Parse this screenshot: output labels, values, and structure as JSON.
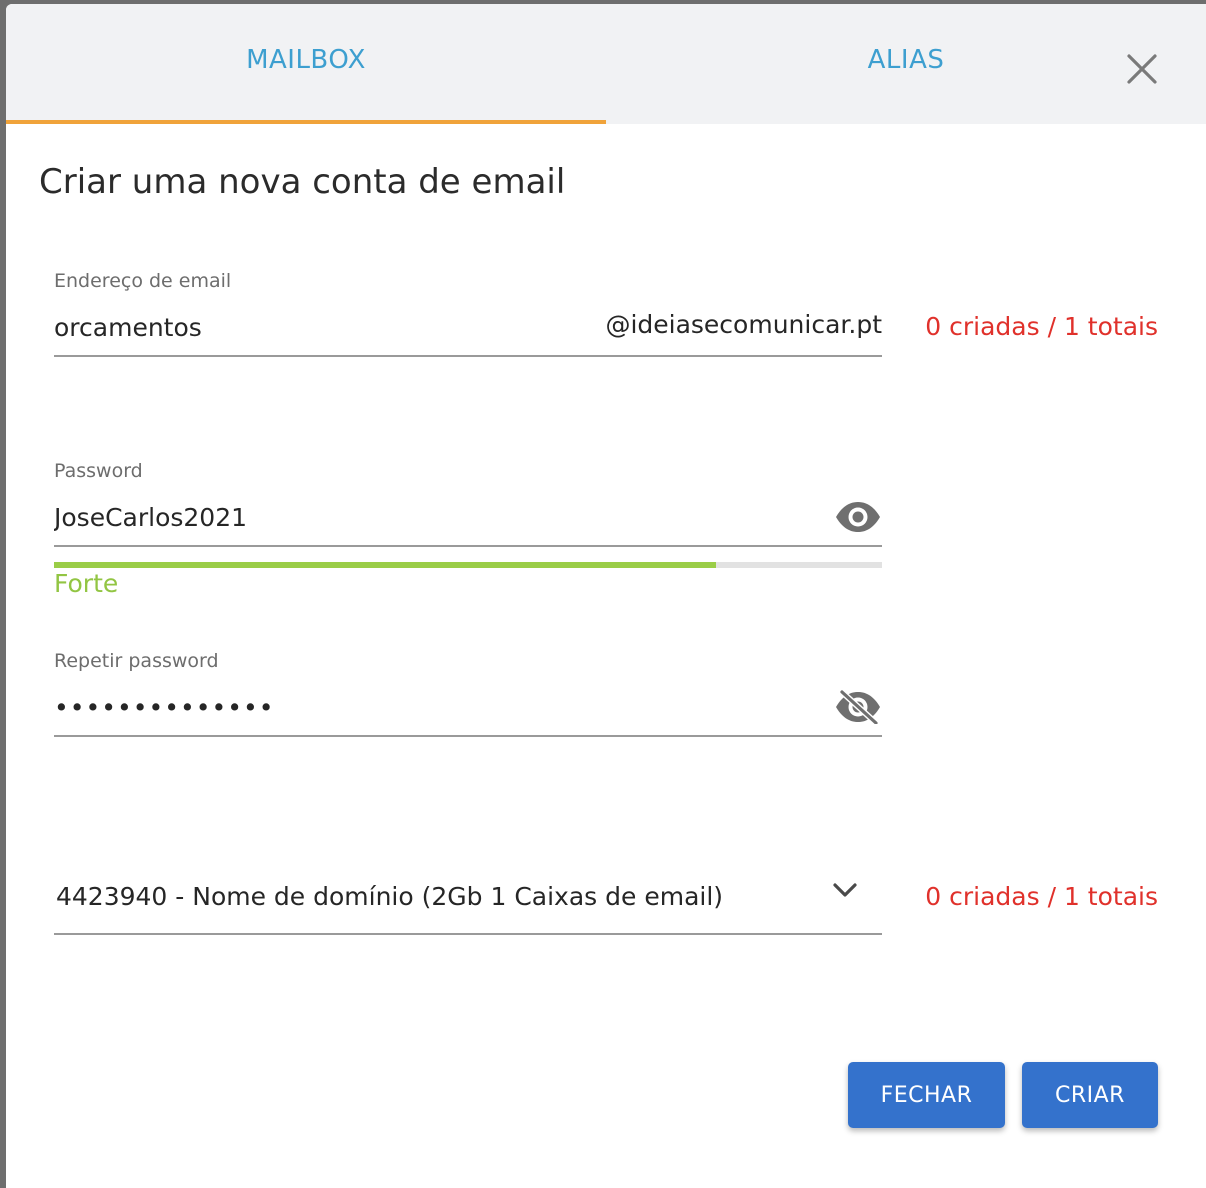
{
  "tabs": [
    {
      "label": "MAILBOX",
      "active": true
    },
    {
      "label": "ALIAS",
      "active": false
    }
  ],
  "dialog": {
    "title": "Criar uma nova conta de email"
  },
  "email_field": {
    "label": "Endereço de email",
    "value": "orcamentos",
    "domain_suffix": "@ideiasecomunicar.pt",
    "quota": "0 criadas / 1 totais"
  },
  "password_field": {
    "label": "Password",
    "value": "JoseCarlos2021",
    "visible": true,
    "strength_label": "Forte",
    "strength_level": 0.8
  },
  "repeat_password_field": {
    "label": "Repetir password",
    "value": "JoseCarlos2021",
    "visible": false
  },
  "plan_select": {
    "selected": "4423940 - Nome de domínio (2Gb 1 Caixas de email)",
    "quota": "0 criadas / 1 totais"
  },
  "buttons": {
    "close_label": "FECHAR",
    "create_label": "CRIAR"
  },
  "colors": {
    "tab_text": "#3d9fd0",
    "tab_indicator": "#f0a33a",
    "quota_text": "#e0312b",
    "strength": "#9acd47",
    "button": "#3472cc"
  },
  "icons": {
    "close": "close-icon",
    "show_password": "eye-icon",
    "hidden_password": "eye-off-icon",
    "dropdown": "chevron-down-icon"
  }
}
